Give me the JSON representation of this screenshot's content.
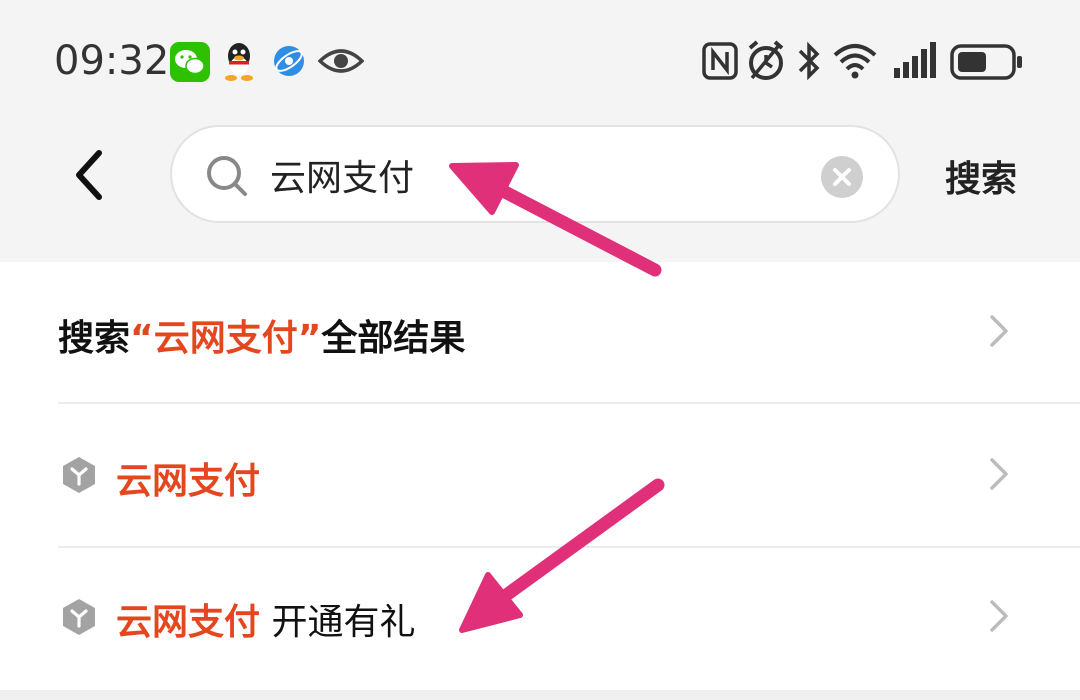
{
  "status_bar": {
    "time": "09:32",
    "left_icons": [
      "wechat-icon",
      "qq-icon",
      "browser-icon",
      "eye-icon"
    ],
    "right_icons": [
      "nfc-icon",
      "alarm-icon",
      "bluetooth-icon",
      "wifi-icon",
      "signal-icon",
      "battery-icon"
    ]
  },
  "search": {
    "query": "云网支付",
    "button_label": "搜索"
  },
  "results": {
    "all_results": {
      "prefix": "搜索",
      "open_quote": "“",
      "keyword": "云网支付",
      "close_quote": "”",
      "suffix": "全部结果"
    },
    "items": [
      {
        "keyword": "云网支付",
        "rest": ""
      },
      {
        "keyword": "云网支付",
        "rest": " 开通有礼"
      }
    ]
  },
  "colors": {
    "highlight": "#e4461e",
    "annotation_arrow": "#e0307a"
  }
}
